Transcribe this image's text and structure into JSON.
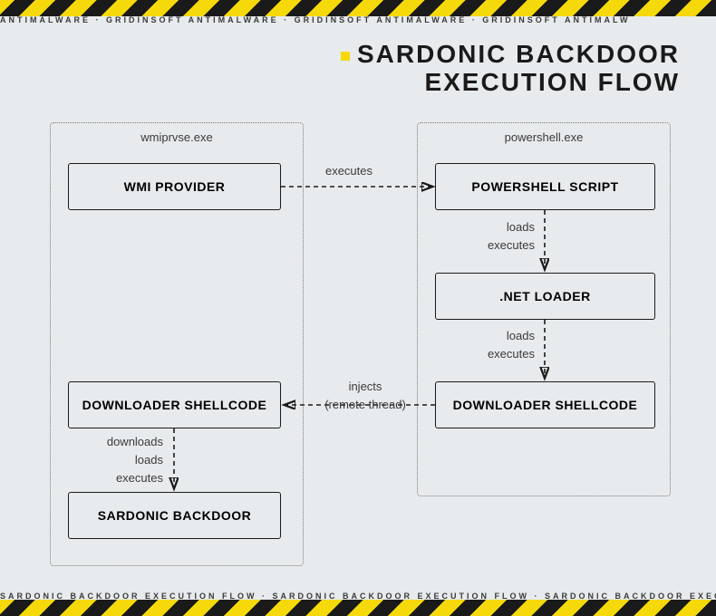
{
  "title_line1": "SARDONIC BACKDOOR",
  "title_line2": "EXECUTION FLOW",
  "ribbon_top_segment": "ANTIMALWARE  ·  GRIDINSOFT ANTIMALWARE  ·  GRIDINSOFT ANTIMALWARE  ·  GRIDINSOFT ANTIMALW",
  "ribbon_bottom_segment": "SARDONIC BACKDOOR EXECUTION FLOW  ·  SARDONIC BACKDOOR EXECUTION FLOW  ·  SARDONIC BACKDOOR EXECUT",
  "processes": {
    "left": {
      "name": "wmiprvse.exe"
    },
    "right": {
      "name": "powershell.exe"
    }
  },
  "nodes": {
    "wmi": "WMI PROVIDER",
    "ps_script": "POWERSHELL SCRIPT",
    "net_loader": ".NET LOADER",
    "dl_shell_r": "DOWNLOADER SHELLCODE",
    "dl_shell_l": "DOWNLOADER SHELLCODE",
    "backdoor": "SARDONIC BACKDOOR"
  },
  "edges": {
    "e1": "executes",
    "e2a": "loads",
    "e2b": "executes",
    "e3a": "loads",
    "e3b": "executes",
    "e4a": "injects",
    "e4b": "(remote thread)",
    "e5a": "downloads",
    "e5b": "loads",
    "e5c": "executes"
  }
}
